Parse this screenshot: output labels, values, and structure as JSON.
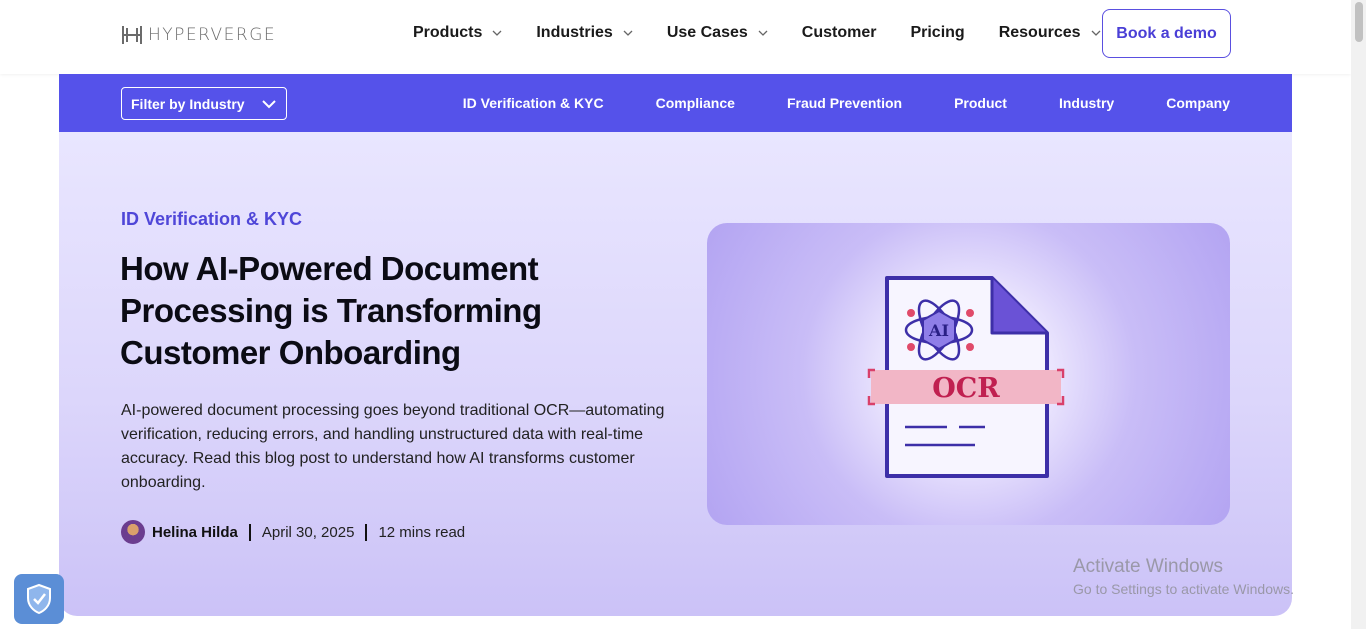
{
  "brand": {
    "logo_text": "HYPERVERGE"
  },
  "nav": {
    "items": [
      {
        "label": "Products",
        "has_dropdown": true
      },
      {
        "label": "Industries",
        "has_dropdown": true
      },
      {
        "label": "Use Cases",
        "has_dropdown": true
      },
      {
        "label": "Customer",
        "has_dropdown": false
      },
      {
        "label": "Pricing",
        "has_dropdown": false
      },
      {
        "label": "Resources",
        "has_dropdown": true
      }
    ],
    "cta_label": "Book a demo"
  },
  "category_bar": {
    "filter_label": "Filter by Industry",
    "links": [
      "ID Verification & KYC",
      "Compliance",
      "Fraud Prevention",
      "Product",
      "Industry",
      "Company"
    ]
  },
  "article": {
    "category": "ID Verification & KYC",
    "title": "How AI-Powered Document Processing is Transforming Customer Onboarding",
    "description": "AI-powered document processing goes beyond traditional OCR—automating verification, reducing errors, and handling unstructured data with real-time accuracy. Read this blog post to understand how AI transforms customer onboarding.",
    "author": "Helina Hilda",
    "date": "April 30, 2025",
    "read_time": "12 mins read",
    "image_labels": {
      "badge": "AI",
      "banner": "OCR"
    }
  },
  "os_overlay": {
    "title": "Activate Windows",
    "subtitle": "Go to Settings to activate Windows."
  },
  "colors": {
    "accent": "#5552ea",
    "hero_bg": "#e2ddfc",
    "title_text": "#0b0b14"
  }
}
